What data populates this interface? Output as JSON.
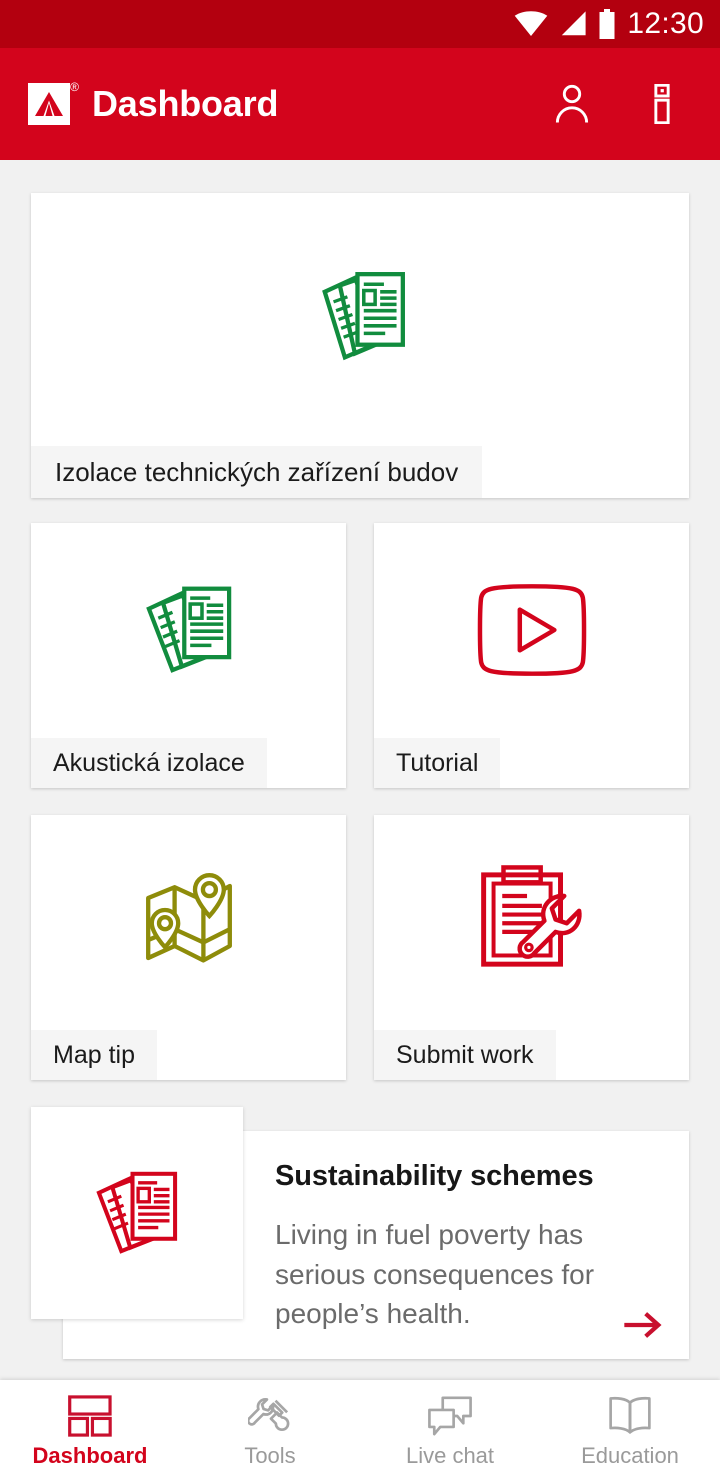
{
  "status_bar": {
    "time": "12:30",
    "icons": [
      "wifi-icon",
      "cellular-signal-icon",
      "battery-icon"
    ]
  },
  "app_bar": {
    "logo": "rockwool-logo-icon",
    "title": "Dashboard",
    "actions": [
      {
        "name": "account-icon",
        "label": "Account"
      },
      {
        "name": "info-icon",
        "label": "Info"
      }
    ]
  },
  "colors": {
    "brand_red": "#d3041c",
    "status_bar_red": "#b3000f",
    "green": "#118c3e",
    "olive": "#8e8c0a",
    "page_bg": "#f1f1f1",
    "label_bg": "#f5f5f5",
    "muted_text": "#6b6b6b"
  },
  "cards": {
    "hero": {
      "label": "Izolace technických zařízení budov",
      "icon": "documents-stack-icon",
      "icon_color": "#118c3e"
    },
    "acoustic": {
      "label": "Akustická izolace",
      "icon": "documents-stack-icon",
      "icon_color": "#118c3e"
    },
    "tutorial": {
      "label": "Tutorial",
      "icon": "video-play-icon",
      "icon_color": "#d3041c"
    },
    "map": {
      "label": "Map tip",
      "icon": "folded-map-pins-icon",
      "icon_color": "#8e8c0a"
    },
    "submit": {
      "label": "Submit work",
      "icon": "clipboard-wrench-icon",
      "icon_color": "#d3041c"
    }
  },
  "sustainability": {
    "title": "Sustainability schemes",
    "text": "Living in fuel poverty has serious consequences for people’s health.",
    "icon": "documents-stack-icon",
    "arrow": "arrow-right-icon"
  },
  "bottom_nav": {
    "items": [
      {
        "label": "Dashboard",
        "icon": "dashboard-grid-icon",
        "active": true
      },
      {
        "label": "Tools",
        "icon": "wrench-screwdriver-icon",
        "active": false
      },
      {
        "label": "Live chat",
        "icon": "chat-bubbles-icon",
        "active": false
      },
      {
        "label": "Education",
        "icon": "open-book-icon",
        "active": false
      }
    ]
  }
}
